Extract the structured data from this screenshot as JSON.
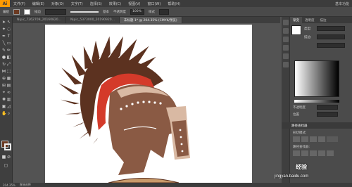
{
  "app": {
    "logo": "Ai"
  },
  "menu": [
    "文件(F)",
    "编辑(E)",
    "对象(O)",
    "文字(T)",
    "选择(S)",
    "效果(C)",
    "视图(V)",
    "窗口(W)",
    "帮助(H)"
  ],
  "menu_right": "基本功能",
  "control_bar": {
    "label": "编组",
    "stroke_label": "描边",
    "stroke_value": "基本",
    "opacity_label": "不透明度",
    "opacity_value": "100%",
    "style_label": "样式"
  },
  "doc_tabs": [
    {
      "label": "Nipic_7262709_20160820..."
    },
    {
      "label": "Nipic_5373000_20190920..."
    },
    {
      "label": "未标题-1* @ 204.35% (CMYK/预览)",
      "active": true
    }
  ],
  "panel": {
    "tabs": [
      "渐变",
      "透明度",
      "描边"
    ],
    "type_label": "类型:",
    "stroke_label": "描边:",
    "opacity_label": "不透明度",
    "location_label": "位置",
    "layers_title": "路径查找器",
    "shape_modes": "形状模式:",
    "pathfinder_label": "路径查找器:"
  },
  "fill_color": "#6b3a22",
  "stroke_color": "#ffffff",
  "helmet_colors": {
    "base": "#8a5a44",
    "dark": "#5c3220",
    "crest_red": "#d43a2a",
    "accent": "#d9b9a3",
    "rivet": "#ffffff"
  },
  "status": {
    "zoom": "204.35%",
    "tool": "直接选择"
  },
  "watermark": "经验",
  "watermark_url": "jingyan.baidu.com"
}
